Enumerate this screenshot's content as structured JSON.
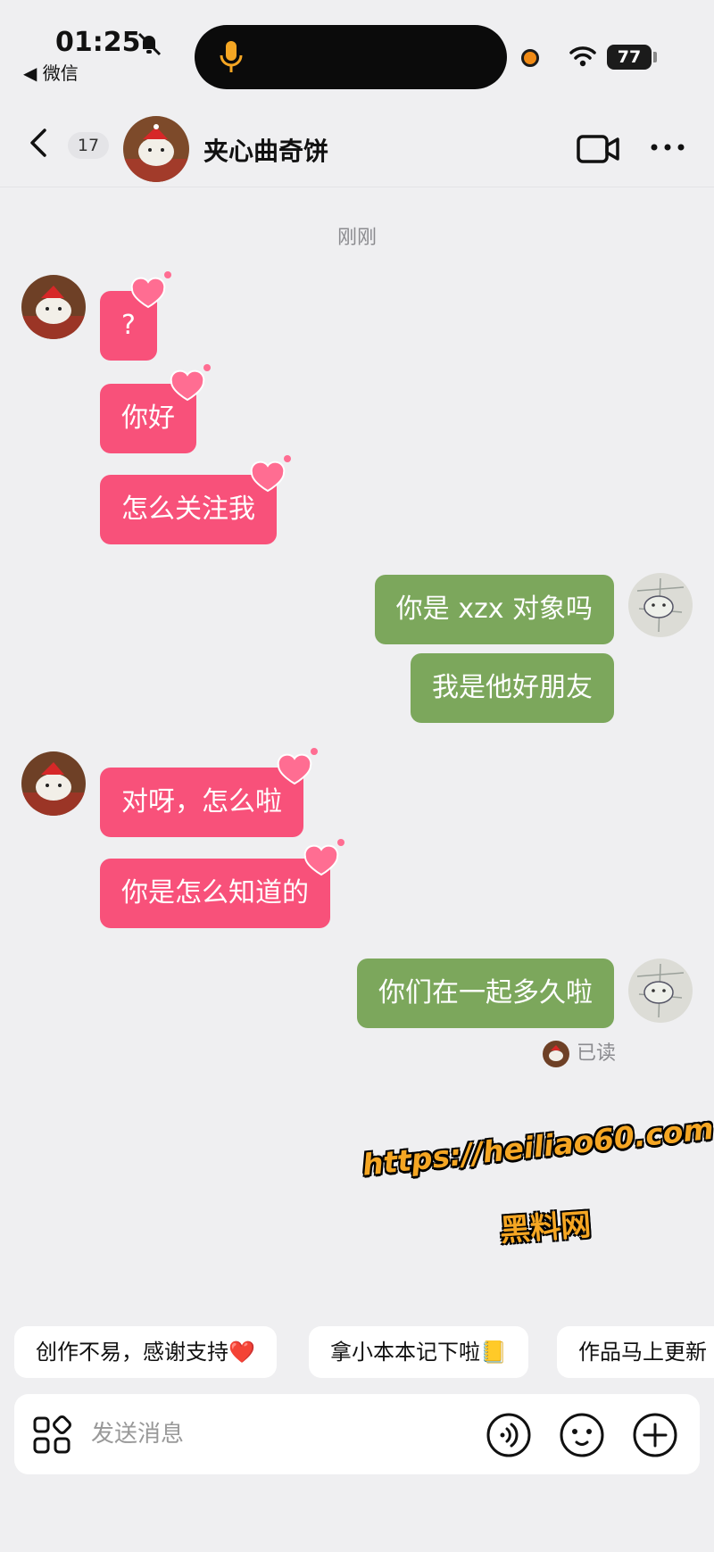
{
  "status_bar": {
    "time": "01:25",
    "back_app": "◀ 微信",
    "battery": "77"
  },
  "header": {
    "unread_count": "17",
    "contact_name": "夹心曲奇饼"
  },
  "time_separator": "刚刚",
  "messages": [
    {
      "side": "left",
      "text": "?"
    },
    {
      "side": "left",
      "text": "你好"
    },
    {
      "side": "left",
      "text": "怎么关注我"
    },
    {
      "side": "right",
      "text": "你是 xzx 对象吗"
    },
    {
      "side": "right",
      "text": "我是他好朋友"
    },
    {
      "side": "left",
      "text": "对呀，怎么啦"
    },
    {
      "side": "left",
      "text": "你是怎么知道的"
    },
    {
      "side": "right",
      "text": "你们在一起多久啦"
    }
  ],
  "read_status": "已读",
  "watermark": {
    "url": "https://heiliao60.com",
    "name": "黑料网"
  },
  "quick_replies": [
    "创作不易，感谢支持❤️",
    "拿小本本记下啦📒",
    "作品马上更新"
  ],
  "input": {
    "placeholder": "发送消息"
  },
  "colors": {
    "pink_bubble": "#f8517a",
    "green_bubble": "#7ca75c",
    "background": "#efeff1"
  }
}
